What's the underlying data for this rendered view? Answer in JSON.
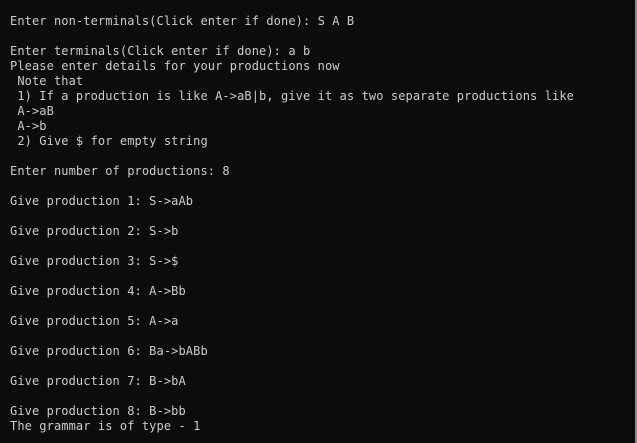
{
  "console": {
    "background": "#0c0c0c",
    "text_color": "#cccccc",
    "lines": [
      "Enter non-terminals(Click enter if done): S A B",
      "",
      "Enter terminals(Click enter if done): a b",
      "Please enter details for your productions now",
      " Note that",
      " 1) If a production is like A->aB|b, give it as two separate productions like",
      " A->aB",
      " A->b",
      " 2) Give $ for empty string",
      "",
      "Enter number of productions: 8",
      "",
      "Give production 1: S->aAb",
      "",
      "Give production 2: S->b",
      "",
      "Give production 3: S->$",
      "",
      "Give production 4: A->Bb",
      "",
      "Give production 5: A->a",
      "",
      "Give production 6: Ba->bABb",
      "",
      "Give production 7: B->bA",
      "",
      "Give production 8: B->bb",
      "The grammar is of type - 1"
    ]
  }
}
